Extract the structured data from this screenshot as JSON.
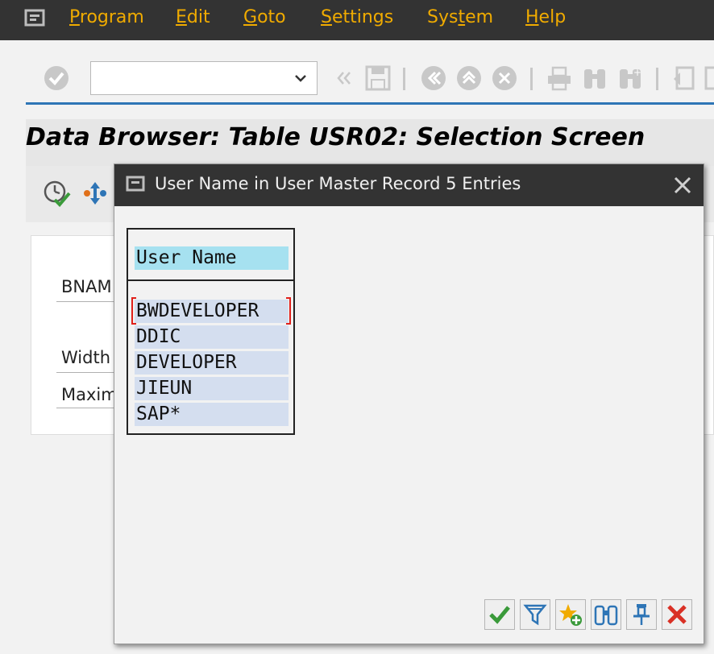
{
  "menubar": {
    "items": [
      {
        "key": "P",
        "rest": "rogram"
      },
      {
        "key": "E",
        "rest": "dit"
      },
      {
        "key": "G",
        "rest": "oto"
      },
      {
        "key": "S",
        "rest": "ettings"
      },
      {
        "key": "",
        "rest": "System",
        "pre": "Sys",
        "ukey": "t",
        "post": "em"
      },
      {
        "key": "H",
        "rest": "elp"
      }
    ]
  },
  "toolbar": {
    "command_field_value": "",
    "icons": [
      "enter-icon",
      "back-arrows-icon",
      "save-icon",
      "back-icon",
      "exit-icon",
      "cancel-icon",
      "print-icon",
      "find-icon",
      "find-next-icon",
      "first-page-icon"
    ]
  },
  "screen": {
    "title": "Data Browser: Table USR02: Selection Screen",
    "fields": [
      {
        "label": "BNAM"
      },
      {
        "label": "Width"
      },
      {
        "label": "Maxim"
      }
    ]
  },
  "dialog": {
    "title": "User Name in User Master Record   5 Entries",
    "column_header": "User Name",
    "rows": [
      "BWDEVELOPER",
      "DDIC",
      "DEVELOPER",
      "JIEUN",
      "SAP*"
    ],
    "selected_row": 0,
    "buttons": [
      "confirm",
      "filter",
      "favorites-add",
      "find",
      "pin",
      "cancel"
    ]
  },
  "colors": {
    "menubar_bg": "#333333",
    "menu_text": "#f0ab00",
    "header_highlight": "#a6e1f0",
    "row_bg": "#d4deef",
    "accent_line": "#2e75b6"
  }
}
